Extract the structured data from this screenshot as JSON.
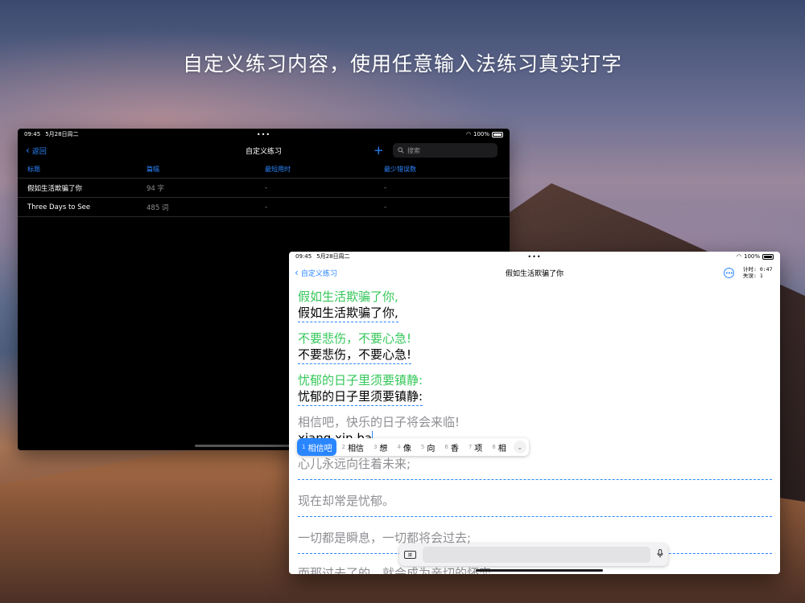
{
  "headline": "自定义练习内容，使用任意输入法练习真实打字",
  "dark_window": {
    "status": {
      "time": "09:45",
      "date": "5月28日周二",
      "dots": "•••",
      "battery": "100%"
    },
    "nav": {
      "back": "返回",
      "title": "自定义练习",
      "add": "+",
      "search_placeholder": "搜索"
    },
    "columns": [
      "标题",
      "篇幅",
      "最短用时",
      "最少错误数"
    ],
    "rows": [
      {
        "title": "假如生活欺骗了你",
        "length": "94 字",
        "time": "-",
        "errors": "-"
      },
      {
        "title": "Three Days to See",
        "length": "485 词",
        "time": "-",
        "errors": "-"
      }
    ]
  },
  "light_window": {
    "status": {
      "time": "09:45",
      "date": "5月28日周二",
      "dots": "•••",
      "battery": "100%"
    },
    "nav": {
      "back": "自定义练习",
      "title": "假如生活欺骗了你",
      "more": "•••"
    },
    "stats": {
      "timer": "计时: 0:47",
      "errors": "失误: 1"
    },
    "lines": [
      {
        "source": "假如生活欺骗了你,",
        "typed": "假如生活欺骗了你,"
      },
      {
        "source": "不要悲伤，不要心急!",
        "typed": "不要悲伤，不要心急!"
      },
      {
        "source": "忧郁的日子里须要镇静:",
        "typed": "忧郁的日子里须要镇静:"
      },
      {
        "source": "相信吧，快乐的日子将会来临!",
        "typed": "xiang xin ba"
      },
      {
        "source": "心儿永远向往着未来;",
        "typed": ""
      },
      {
        "source": "现在却常是忧郁。",
        "typed": ""
      },
      {
        "source": "一切都是瞬息，一切都将会过去;",
        "typed": ""
      },
      {
        "source": "而那过去了的，就会成为亲切的怀恋。",
        "typed": ""
      }
    ],
    "candidates": [
      {
        "n": "1",
        "text": "相信吧"
      },
      {
        "n": "2",
        "text": "相信"
      },
      {
        "n": "3",
        "text": "想"
      },
      {
        "n": "4",
        "text": "像"
      },
      {
        "n": "5",
        "text": "向"
      },
      {
        "n": "6",
        "text": "香"
      },
      {
        "n": "7",
        "text": "项"
      },
      {
        "n": "8",
        "text": "相"
      }
    ],
    "keyboard": {
      "ime_label": "拼"
    }
  }
}
